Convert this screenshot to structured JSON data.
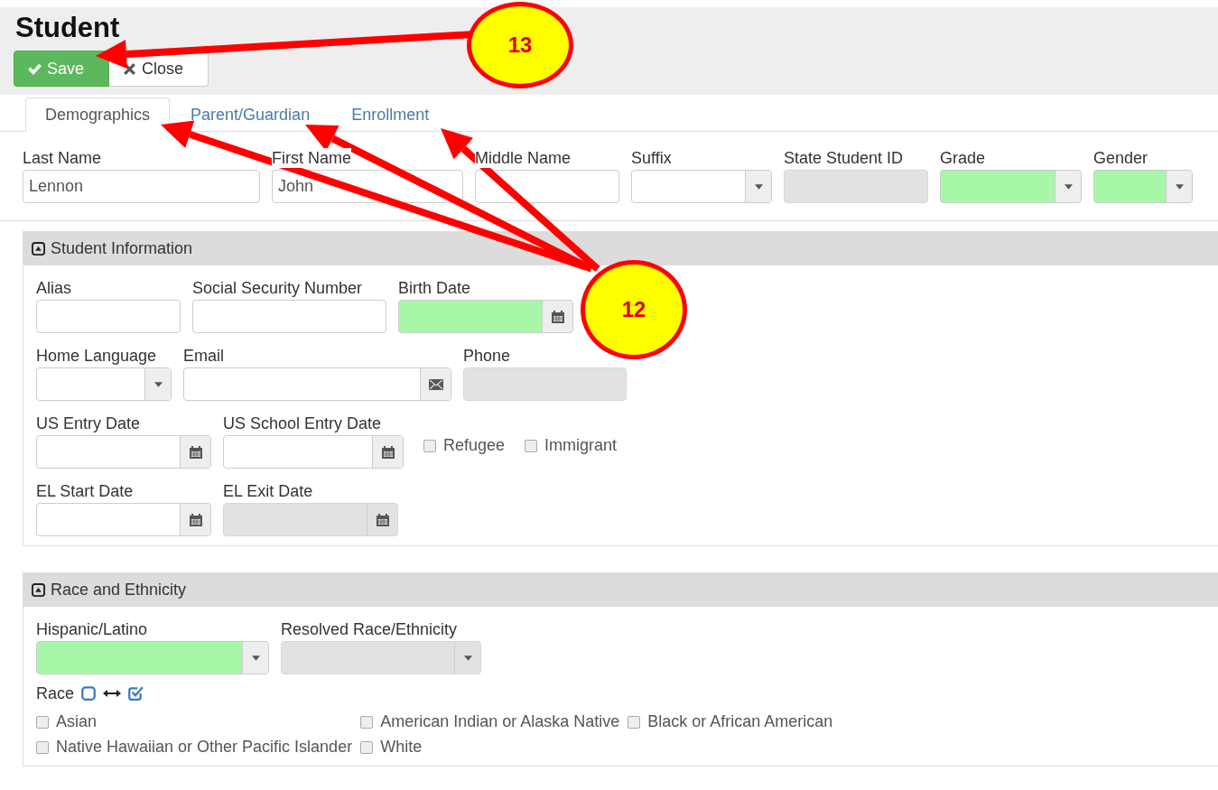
{
  "page": {
    "title": "Student"
  },
  "toolbar": [
    {
      "label": "Save",
      "kind": "save"
    },
    {
      "label": "Close",
      "kind": "close"
    }
  ],
  "tabs": [
    {
      "label": "Demographics",
      "selected": true
    },
    {
      "label": "Parent/Guardian",
      "selected": false
    },
    {
      "label": "Enrollment",
      "selected": false
    }
  ],
  "top_fields": [
    {
      "label": "Last Name",
      "value": "Lennon",
      "kind": "text",
      "required": false,
      "disabled": false
    },
    {
      "label": "First Name",
      "value": "John",
      "kind": "text",
      "required": false,
      "disabled": false
    },
    {
      "label": "Middle Name",
      "kind": "text",
      "required": false,
      "disabled": false
    },
    {
      "label": "Suffix",
      "kind": "select",
      "required": false,
      "disabled": false
    },
    {
      "label": "State Student ID",
      "kind": "text",
      "required": false,
      "disabled": true
    },
    {
      "label": "Grade",
      "kind": "select",
      "required": true,
      "disabled": false
    },
    {
      "label": "Gender",
      "kind": "select",
      "required": true,
      "disabled": false
    }
  ],
  "sections": [
    {
      "title": "Student Information",
      "expanded": true,
      "rows": [
        [
          {
            "label": "Alias",
            "kind": "text",
            "required": false,
            "disabled": false
          },
          {
            "label": "Social Security Number",
            "kind": "text",
            "required": false,
            "disabled": false
          },
          {
            "label": "Birth Date",
            "kind": "date",
            "required": true,
            "disabled": false
          }
        ],
        [
          {
            "label": "Home Language",
            "kind": "select",
            "required": false,
            "disabled": false
          },
          {
            "label": "Email",
            "kind": "email",
            "required": false,
            "disabled": false
          },
          {
            "label": "Phone",
            "kind": "text",
            "required": false,
            "disabled": true
          }
        ],
        [
          {
            "label": "US Entry Date",
            "kind": "date",
            "required": false,
            "disabled": false
          },
          {
            "label": "US School Entry Date",
            "kind": "date",
            "required": false,
            "disabled": false
          },
          {
            "label": "Refugee",
            "kind": "checkbox",
            "checked": false
          },
          {
            "label": "Immigrant",
            "kind": "checkbox",
            "checked": false
          }
        ],
        [
          {
            "label": "EL Start Date",
            "kind": "date",
            "required": false,
            "disabled": false
          },
          {
            "label": "EL Exit Date",
            "kind": "date",
            "required": false,
            "disabled": true
          }
        ]
      ]
    },
    {
      "title": "Race and Ethnicity",
      "expanded": true,
      "rows": [
        [
          {
            "label": "Hispanic/Latino",
            "kind": "select",
            "required": true,
            "disabled": false
          },
          {
            "label": "Resolved Race/Ethnicity",
            "kind": "select",
            "required": false,
            "disabled": true
          }
        ]
      ],
      "race": {
        "label": "Race",
        "options": [
          {
            "label": "Asian",
            "checked": false
          },
          {
            "label": "American Indian or Alaska Native",
            "checked": false
          },
          {
            "label": "Black or African American",
            "checked": false
          },
          {
            "label": "Native Hawaiian or Other Pacific Islander",
            "checked": false
          },
          {
            "label": "White",
            "checked": false
          }
        ]
      }
    }
  ],
  "callouts": [
    {
      "label": "13"
    },
    {
      "label": "12"
    }
  ]
}
